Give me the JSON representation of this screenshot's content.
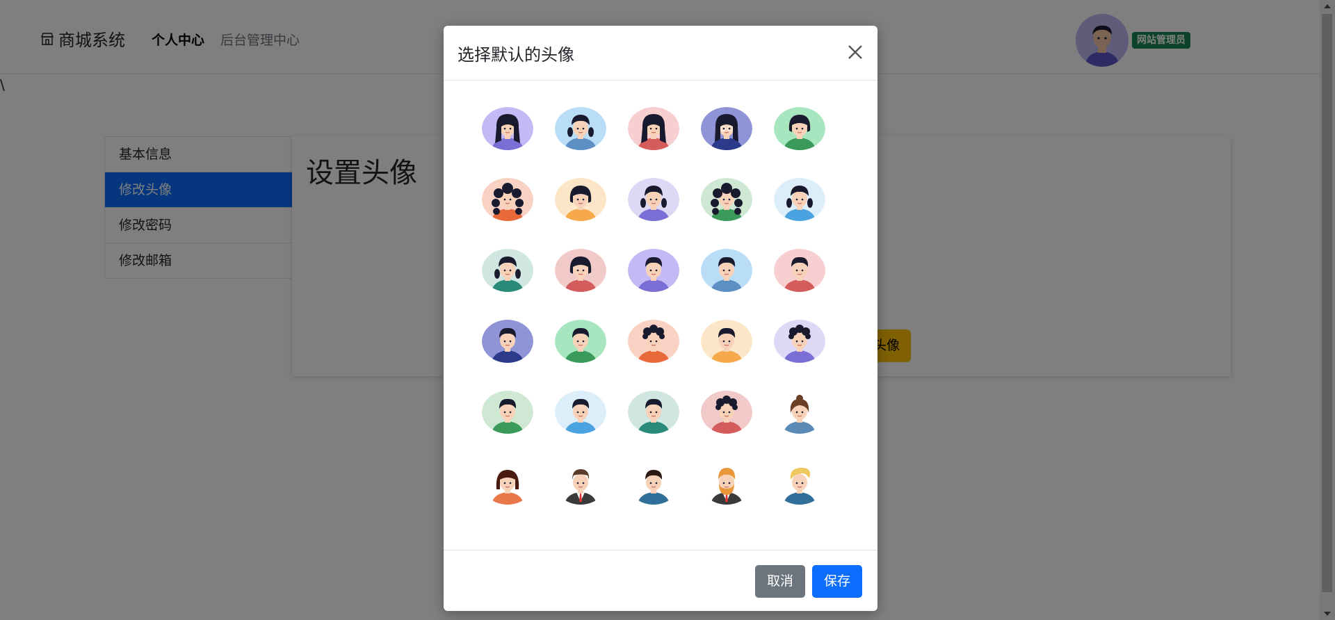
{
  "navbar": {
    "brand": "商城系统",
    "links": [
      {
        "label": "个人中心",
        "active": true
      },
      {
        "label": "后台管理中心",
        "active": false
      }
    ],
    "role_badge": "网站管理员"
  },
  "stray_text": "\\",
  "sidebar": {
    "items": [
      {
        "label": "基本信息",
        "active": false
      },
      {
        "label": "修改头像",
        "active": true
      },
      {
        "label": "修改密码",
        "active": false
      },
      {
        "label": "修改邮箱",
        "active": false
      }
    ]
  },
  "panel": {
    "title": "设置头像",
    "button_partial": "头像"
  },
  "modal": {
    "title": "选择默认的头像",
    "cancel_label": "取消",
    "save_label": "保存",
    "avatars": [
      {
        "bg": "#c3b9f5",
        "hair": "#1a1a2e",
        "shirt": "#7b6fd6",
        "style": "girl-long"
      },
      {
        "bg": "#b9dcf7",
        "hair": "#1a1a2e",
        "shirt": "#5c8fc4",
        "style": "girl-braids"
      },
      {
        "bg": "#f7cfd0",
        "hair": "#1a1a2e",
        "shirt": "#d45c5c",
        "style": "girl-long"
      },
      {
        "bg": "#8f94d6",
        "hair": "#1a1a2e",
        "shirt": "#2b3a8a",
        "style": "girl-glasses"
      },
      {
        "bg": "#a8e6bf",
        "hair": "#1a1a2e",
        "shirt": "#3a9a5a",
        "style": "girl-bob"
      },
      {
        "bg": "#f9d2c4",
        "hair": "#1a1a2e",
        "shirt": "#e86a3a",
        "style": "girl-curly"
      },
      {
        "bg": "#fde6c8",
        "hair": "#1a1a2e",
        "shirt": "#f5a94a",
        "style": "girl-bob"
      },
      {
        "bg": "#dcd8f5",
        "hair": "#1a1a2e",
        "shirt": "#7b6fd6",
        "style": "girl-braids"
      },
      {
        "bg": "#cfe8d4",
        "hair": "#1a1a2e",
        "shirt": "#3a9a5a",
        "style": "girl-curly"
      },
      {
        "bg": "#dceefa",
        "hair": "#1a1a2e",
        "shirt": "#4aa3e0",
        "style": "girl-braids"
      },
      {
        "bg": "#cfe6e1",
        "hair": "#1a1a2e",
        "shirt": "#2a8a7a",
        "style": "girl-braids"
      },
      {
        "bg": "#f2c9c9",
        "hair": "#1a1a2e",
        "shirt": "#d45c5c",
        "style": "girl-bob"
      },
      {
        "bg": "#c3b9f5",
        "hair": "#1a1a2e",
        "shirt": "#7b6fd6",
        "style": "boy"
      },
      {
        "bg": "#b9dcf7",
        "hair": "#1a1a2e",
        "shirt": "#5c8fc4",
        "style": "boy"
      },
      {
        "bg": "#f7cfd0",
        "hair": "#1a1a2e",
        "shirt": "#d45c5c",
        "style": "boy"
      },
      {
        "bg": "#8f94d6",
        "hair": "#1a1a2e",
        "shirt": "#2b3a8a",
        "style": "boy"
      },
      {
        "bg": "#a8e6bf",
        "hair": "#1a1a2e",
        "shirt": "#3a9a5a",
        "style": "boy"
      },
      {
        "bg": "#f9d2c4",
        "hair": "#1a1a2e",
        "shirt": "#e86a3a",
        "style": "boy-curly"
      },
      {
        "bg": "#fde6c8",
        "hair": "#1a1a2e",
        "shirt": "#f5a94a",
        "style": "boy"
      },
      {
        "bg": "#dcd8f5",
        "hair": "#1a1a2e",
        "shirt": "#7b6fd6",
        "style": "boy-curly"
      },
      {
        "bg": "#cfe8d4",
        "hair": "#1a1a2e",
        "shirt": "#3a9a5a",
        "style": "boy"
      },
      {
        "bg": "#dceefa",
        "hair": "#1a1a2e",
        "shirt": "#4aa3e0",
        "style": "boy"
      },
      {
        "bg": "#cfe6e1",
        "hair": "#1a1a2e",
        "shirt": "#2a8a7a",
        "style": "boy"
      },
      {
        "bg": "#f2c9c9",
        "hair": "#1a1a2e",
        "shirt": "#d45c5c",
        "style": "boy-curly"
      },
      {
        "bg": "#ffffff",
        "hair": "#6b3e26",
        "shirt": "#5a8ab5",
        "style": "woman-flat"
      },
      {
        "bg": "#ffffff",
        "hair": "#4a1a10",
        "shirt": "#e8784a",
        "style": "woman-flat-bob"
      },
      {
        "bg": "#ffffff",
        "hair": "#5a3a2a",
        "shirt": "#3a3a3a",
        "style": "man-suit"
      },
      {
        "bg": "#ffffff",
        "hair": "#2a1a12",
        "shirt": "#2f6f9a",
        "style": "man-flat"
      },
      {
        "bg": "#ffffff",
        "hair": "#e8983a",
        "shirt": "#3a3a3a",
        "style": "man-beard"
      },
      {
        "bg": "#ffffff",
        "hair": "#f0c860",
        "shirt": "#2f6f9a",
        "style": "man-blond"
      }
    ]
  },
  "colors": {
    "primary": "#0d6efd",
    "secondary": "#6c757d",
    "success": "#198754",
    "warning": "#ffc107"
  }
}
